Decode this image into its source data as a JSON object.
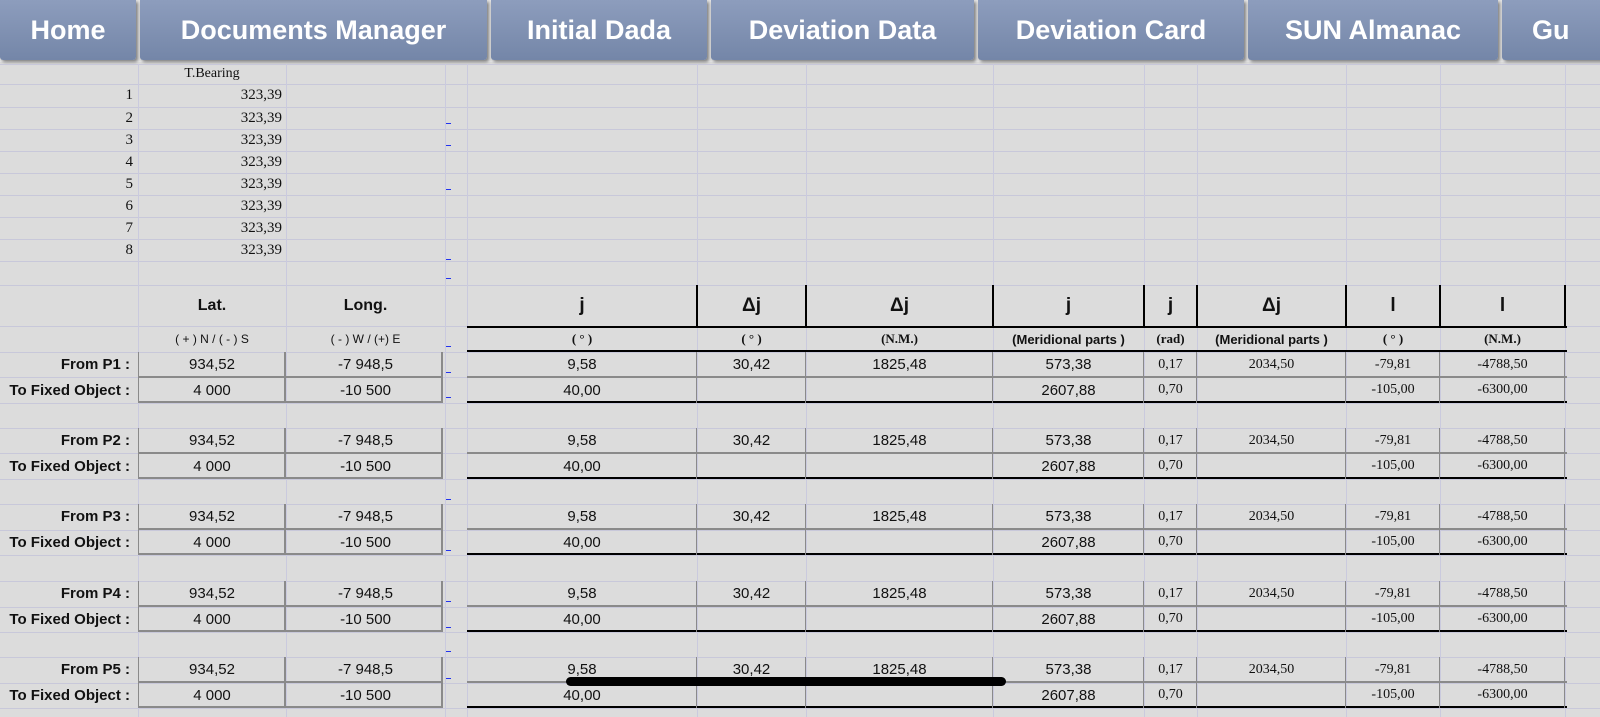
{
  "tabs": [
    {
      "label": "Home"
    },
    {
      "label": "Documents Manager"
    },
    {
      "label": "Initial Dada"
    },
    {
      "label": "Deviation Data"
    },
    {
      "label": "Deviation Card"
    },
    {
      "label": "SUN Almanac"
    },
    {
      "label": "Gu"
    }
  ],
  "bearings": {
    "header": "T.Bearing",
    "rows": [
      {
        "n": "1",
        "v": "323,39"
      },
      {
        "n": "2",
        "v": "323,39"
      },
      {
        "n": "3",
        "v": "323,39"
      },
      {
        "n": "4",
        "v": "323,39"
      },
      {
        "n": "5",
        "v": "323,39"
      },
      {
        "n": "6",
        "v": "323,39"
      },
      {
        "n": "7",
        "v": "323,39"
      },
      {
        "n": "8",
        "v": "323,39"
      }
    ]
  },
  "headers": [
    "Lat.",
    "Long.",
    "j",
    "Δj",
    "Δj",
    "j",
    "j",
    "Δj",
    "l",
    "l"
  ],
  "units": [
    "( + ) N  /  ( - ) S",
    "( - ) W  /  (+) E",
    "( ° )",
    "( ° )",
    "(N.M.)",
    "(Meridional parts )",
    "(rad)",
    "(Meridional parts )",
    "( ° )",
    "(N.M.)"
  ],
  "points": [
    {
      "from_label": "From P1 :",
      "to_label": "To Fixed Object :",
      "a": [
        "934,52",
        "-7 948,5",
        "9,58",
        "30,42",
        "1825,48",
        "573,38",
        "0,17",
        "2034,50",
        "-79,81",
        "-4788,50"
      ],
      "b": [
        "4 000",
        "-10 500",
        "40,00",
        "",
        "",
        "2607,88",
        "0,70",
        "",
        "-105,00",
        "-6300,00"
      ]
    },
    {
      "from_label": "From P2 :",
      "to_label": "To Fixed Object :",
      "a": [
        "934,52",
        "-7 948,5",
        "9,58",
        "30,42",
        "1825,48",
        "573,38",
        "0,17",
        "2034,50",
        "-79,81",
        "-4788,50"
      ],
      "b": [
        "4 000",
        "-10 500",
        "40,00",
        "",
        "",
        "2607,88",
        "0,70",
        "",
        "-105,00",
        "-6300,00"
      ]
    },
    {
      "from_label": "From P3 :",
      "to_label": "To Fixed Object :",
      "a": [
        "934,52",
        "-7 948,5",
        "9,58",
        "30,42",
        "1825,48",
        "573,38",
        "0,17",
        "2034,50",
        "-79,81",
        "-4788,50"
      ],
      "b": [
        "4 000",
        "-10 500",
        "40,00",
        "",
        "",
        "2607,88",
        "0,70",
        "",
        "-105,00",
        "-6300,00"
      ]
    },
    {
      "from_label": "From P4 :",
      "to_label": "To Fixed Object :",
      "a": [
        "934,52",
        "-7 948,5",
        "9,58",
        "30,42",
        "1825,48",
        "573,38",
        "0,17",
        "2034,50",
        "-79,81",
        "-4788,50"
      ],
      "b": [
        "4 000",
        "-10 500",
        "40,00",
        "",
        "",
        "2607,88",
        "0,70",
        "",
        "-105,00",
        "-6300,00"
      ]
    },
    {
      "from_label": "From P5 :",
      "to_label": "To Fixed Object :",
      "a": [
        "934,52",
        "-7 948,5",
        "9,58",
        "30,42",
        "1825,48",
        "573,38",
        "0,17",
        "2034,50",
        "-79,81",
        "-4788,50"
      ],
      "b": [
        "4 000",
        "-10 500",
        "40,00",
        "",
        "",
        "2607,88",
        "0,70",
        "",
        "-105,00",
        "-6300,00"
      ]
    }
  ]
}
